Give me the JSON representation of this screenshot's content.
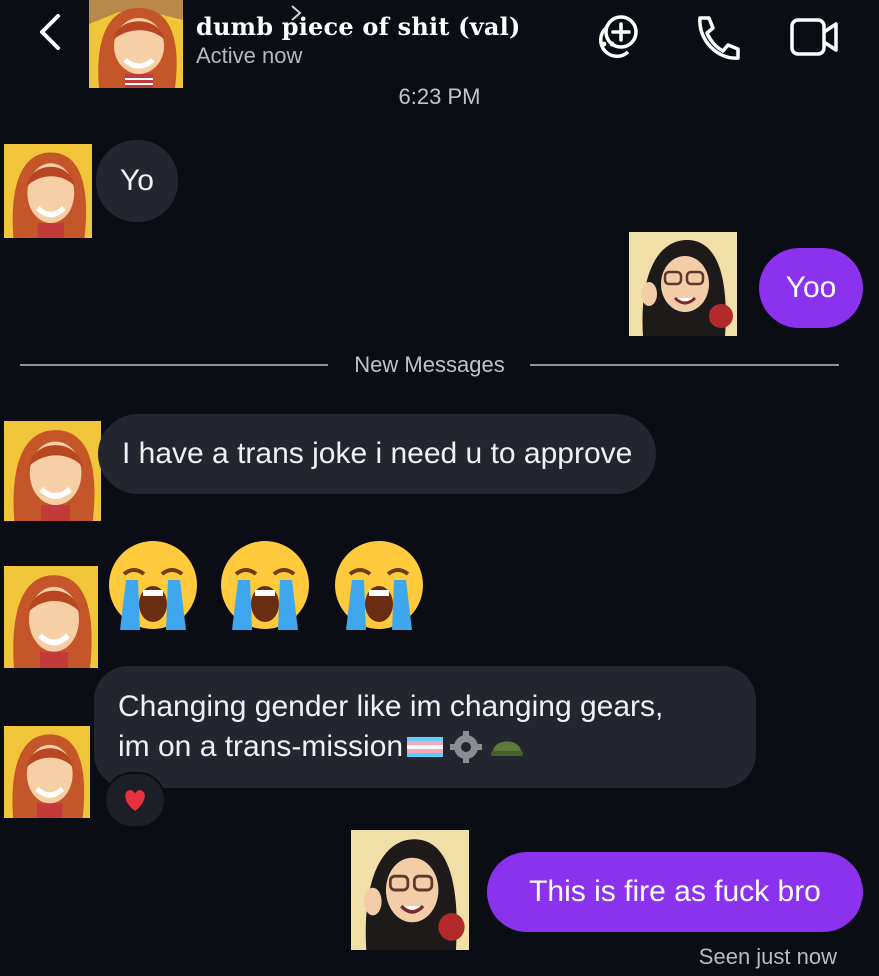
{
  "header": {
    "title": "dumb piece of shit (val)",
    "status": "Active now"
  },
  "timestamp": "6:23 PM",
  "divider": {
    "label": "New Messages"
  },
  "messages": [
    {
      "sender": "them",
      "text": "Yo"
    },
    {
      "sender": "me",
      "text": "Yoo"
    },
    {
      "sender": "them",
      "text": "I have a trans joke i need u to approve"
    },
    {
      "sender": "them",
      "emojis": [
        "😭",
        "😭",
        "😭"
      ]
    },
    {
      "sender": "them",
      "line1": "Changing gender like im changing gears,",
      "line2": "im on a trans-mission",
      "reaction": "❤️"
    },
    {
      "sender": "me",
      "text": "This is fire as fuck bro"
    }
  ],
  "footer": {
    "seen": "Seen just now"
  },
  "colors": {
    "background": "#0b0d14",
    "incoming_bubble": "#23262e",
    "outgoing_bubble": "#8a32ee"
  }
}
